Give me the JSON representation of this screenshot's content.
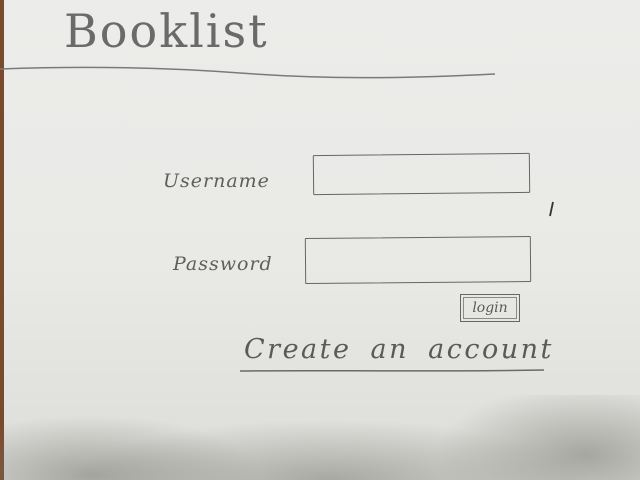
{
  "app": {
    "title": "Booklist"
  },
  "login_form": {
    "username_label": "Username",
    "username_value": "",
    "password_label": "Password",
    "password_value": "",
    "login_button_label": "login"
  },
  "links": {
    "create_account_label": "Create an account"
  },
  "colors": {
    "paper": "#ececea",
    "pencil": "#5a5a5a",
    "table_edge": "#7a4a2c"
  }
}
